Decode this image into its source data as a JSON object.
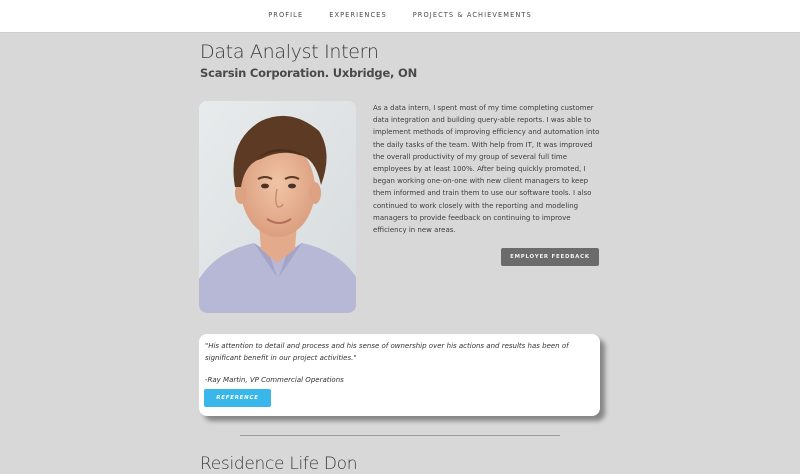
{
  "nav": {
    "items": [
      "PROFILE",
      "EXPERIENCES",
      "PROJECTS & ACHIEVEMENTS"
    ]
  },
  "experience": {
    "title": "Data Analyst Intern",
    "company": "Scarsin Corporation. Uxbridge, ON",
    "description": "As a data intern, I spent most of my time completing customer data integration and building query-able reports. I was able to implement methods of improving efficiency and automation into the daily tasks of the team. With help from IT, It was improved the overall productivity of my group of several full time employees by at least 100%. After being quickly promoted, I began working one-on-one with new client managers to keep them informed and train them to use our software tools. I also continued to work closely with the reporting and modeling managers to provide feedback on continuing to improve efficiency in new areas.",
    "feedback_button": "EMPLOYER FEEDBACK"
  },
  "testimonial": {
    "quote": "\"His attention to detail and process and his sense of ownership over his actions and results has been of significant benefit in our project activities.\"",
    "author": "-Ray Martin, VP Commercial Operations",
    "button": "REFERENCE"
  },
  "next_section": {
    "title": "Residence Life Don"
  },
  "colors": {
    "nav_bg": "#ffffff",
    "page_bg": "#d8d8d8",
    "accent": "#39b7ea",
    "dark_button": "#6b6b6b"
  }
}
